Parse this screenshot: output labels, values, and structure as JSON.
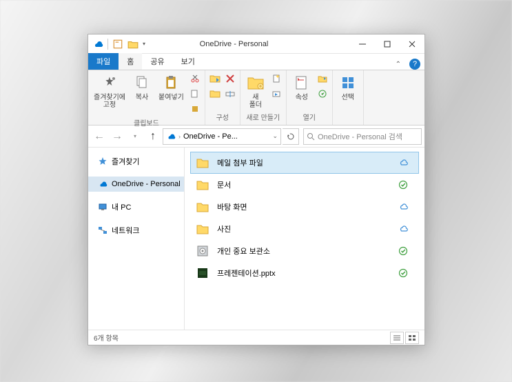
{
  "window": {
    "title": "OneDrive - Personal"
  },
  "tabs": {
    "file": "파일",
    "home": "홈",
    "share": "공유",
    "view": "보기"
  },
  "ribbon": {
    "pin": "즐겨찾기에\n고정",
    "copy": "복사",
    "paste": "붙여넣기",
    "clipboard_group": "클립보드",
    "organize_group": "구성",
    "new_folder": "새\n폴더",
    "new_group": "새로 만들기",
    "properties": "속성",
    "open_group": "열기",
    "select": "선택"
  },
  "address": {
    "crumb": "OneDrive - Pe..."
  },
  "search": {
    "placeholder": "OneDrive - Personal 검색"
  },
  "sidebar": {
    "quick_access": "즐겨찾기",
    "onedrive": "OneDrive - Personal",
    "this_pc": "내 PC",
    "network": "네트워크"
  },
  "items": [
    {
      "name": "메일 첨부 파일",
      "type": "folder",
      "status": "cloud",
      "selected": true
    },
    {
      "name": "문서",
      "type": "folder",
      "status": "synced",
      "selected": false
    },
    {
      "name": "바탕 화면",
      "type": "folder",
      "status": "cloud",
      "selected": false
    },
    {
      "name": "사진",
      "type": "folder",
      "status": "cloud",
      "selected": false
    },
    {
      "name": "개인 중요 보관소",
      "type": "vault",
      "status": "synced",
      "selected": false
    },
    {
      "name": "프레젠테이션.pptx",
      "type": "pptx",
      "status": "synced",
      "selected": false
    }
  ],
  "statusbar": {
    "count": "6개 항목"
  }
}
